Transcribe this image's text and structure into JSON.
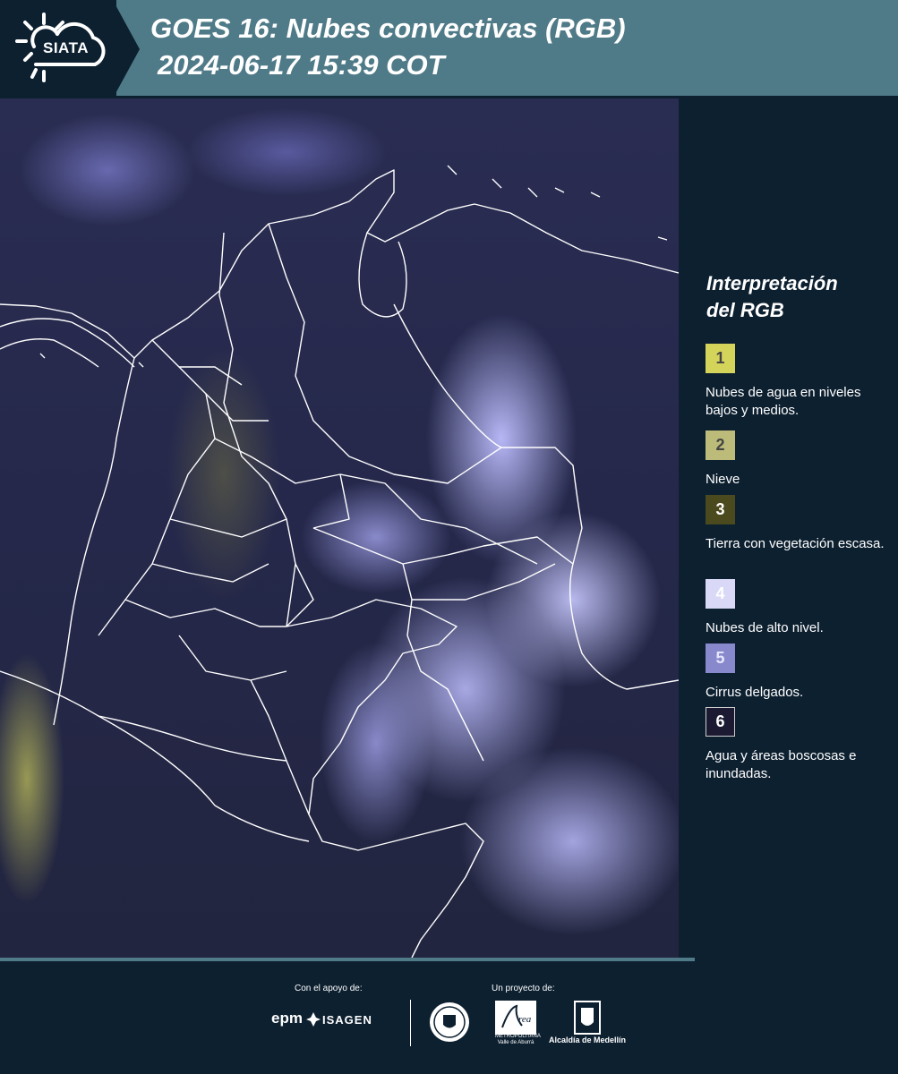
{
  "header": {
    "logo_text": "SIATA",
    "title_line1": "GOES 16: Nubes convectivas (RGB)",
    "title_line2": "2024-06-17 15:39 COT"
  },
  "legend": {
    "title": "Interpretación\ndel RGB",
    "items": [
      {
        "number": "1",
        "label": "Nubes de agua en niveles bajos y medios.",
        "color": "#d5d45a"
      },
      {
        "number": "2",
        "label": "Nieve",
        "color": "#bcbb7a"
      },
      {
        "number": "3",
        "label": "Tierra con vegetación escasa.",
        "color": "#4a4a1e"
      },
      {
        "number": "4",
        "label": "Nubes de alto nivel.",
        "color": "#d9d9f7"
      },
      {
        "number": "5",
        "label": "Cirrus delgados.",
        "color": "#8888cc"
      },
      {
        "number": "6",
        "label": "Agua y áreas boscosas e inundadas.",
        "color": "#1c1a33"
      }
    ]
  },
  "footer": {
    "support_label": "Con el apoyo de:",
    "project_label": "Un proyecto de:",
    "sponsors": [
      "epm",
      "ISAGEN"
    ],
    "partners": [
      "Área Metropolitana Valle de Aburrá",
      "Alcaldía de Medellín"
    ],
    "epm": "epm",
    "isagen": "ISAGEN",
    "metro_line1": "Área",
    "metro_line2": "METROPOLITANA",
    "metro_line3": "Valle de Aburrá",
    "alcaldia": "Alcaldía de Medellín"
  }
}
